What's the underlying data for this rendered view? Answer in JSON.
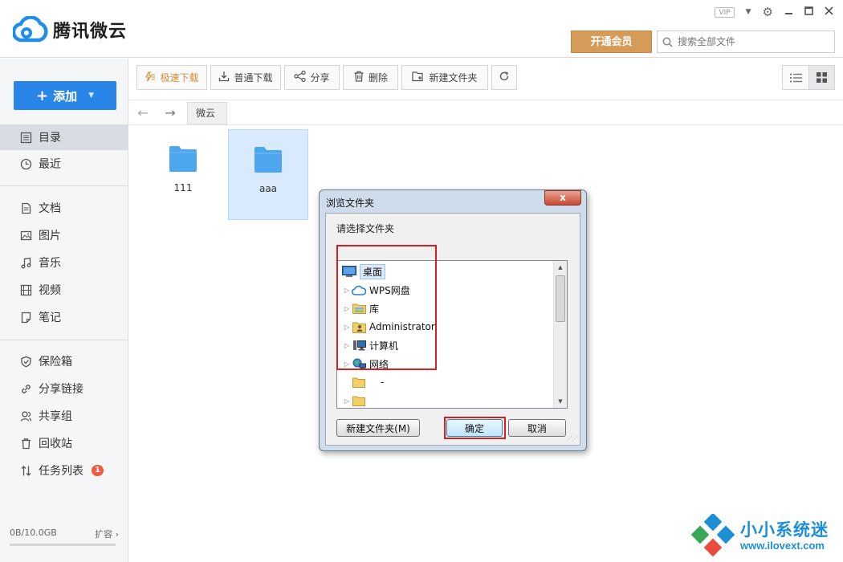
{
  "app": {
    "title": "腾讯微云",
    "vip_label": "VIP",
    "member_button": "开通会员",
    "search_placeholder": "搜索全部文件"
  },
  "sidebar": {
    "add_button": "添加",
    "items_top": [
      {
        "label": "目录",
        "icon": "catalog-icon",
        "active": true
      },
      {
        "label": "最近",
        "icon": "clock-icon"
      }
    ],
    "items_types": [
      {
        "label": "文档",
        "icon": "document-icon"
      },
      {
        "label": "图片",
        "icon": "image-icon"
      },
      {
        "label": "音乐",
        "icon": "music-icon"
      },
      {
        "label": "视频",
        "icon": "video-icon"
      },
      {
        "label": "笔记",
        "icon": "note-icon"
      }
    ],
    "items_tools": [
      {
        "label": "保险箱",
        "icon": "shield-icon"
      },
      {
        "label": "分享链接",
        "icon": "link-icon"
      },
      {
        "label": "共享组",
        "icon": "group-icon"
      },
      {
        "label": "回收站",
        "icon": "trash-icon"
      },
      {
        "label": "任务列表",
        "icon": "transfer-icon",
        "badge": "1"
      }
    ],
    "storage_text": "0B/10.0GB",
    "storage_used_fraction": 0,
    "expand_label": "扩容 ›"
  },
  "toolbar": {
    "buttons": [
      {
        "label": "极速下载",
        "icon": "fast-download-icon"
      },
      {
        "label": "普通下载",
        "icon": "download-icon"
      },
      {
        "label": "分享",
        "icon": "share-icon"
      },
      {
        "label": "删除",
        "icon": "trash-icon"
      },
      {
        "label": "新建文件夹",
        "icon": "new-folder-icon"
      }
    ]
  },
  "breadcrumb": {
    "current": "微云"
  },
  "files": [
    {
      "name": "111",
      "selected": false
    },
    {
      "name": "aaa",
      "selected": true
    }
  ],
  "dialog": {
    "title": "浏览文件夹",
    "close_label": "x",
    "prompt": "请选择文件夹",
    "tree": [
      {
        "label": "桌面",
        "icon": "desktop-icon",
        "selected": true
      },
      {
        "label": "WPS网盘",
        "icon": "cloud-drive-icon"
      },
      {
        "label": "库",
        "icon": "library-icon"
      },
      {
        "label": "Administrator",
        "icon": "user-folder-icon"
      },
      {
        "label": "计算机",
        "icon": "computer-icon"
      },
      {
        "label": "网络",
        "icon": "network-icon"
      },
      {
        "label": "-",
        "icon": "folder-icon"
      },
      {
        "label": "",
        "icon": "folder-icon"
      }
    ],
    "new_folder_button": "新建文件夹(M)",
    "ok_button": "确定",
    "cancel_button": "取消"
  },
  "watermark": {
    "line1": "小小系统迷",
    "line2": "www.ilovext.com"
  },
  "colors": {
    "accent_blue": "#2a85e8",
    "member_gold": "#d59b58",
    "highlight_red": "#d42020"
  }
}
